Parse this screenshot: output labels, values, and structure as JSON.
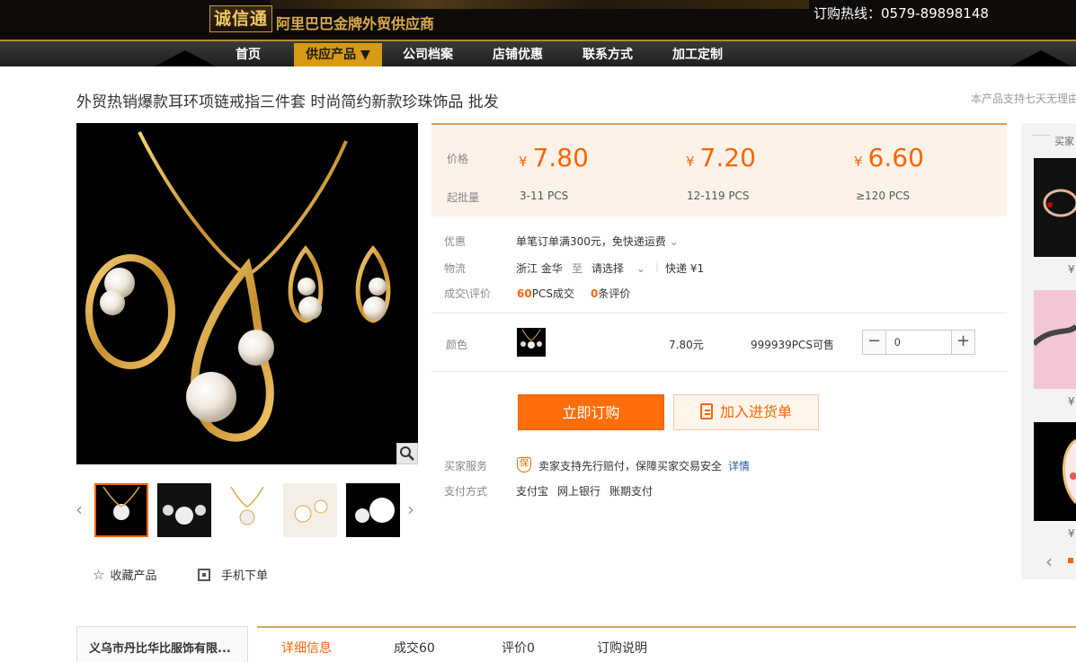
{
  "header": {
    "logo_badge": "诚信通",
    "logo_text": "阿里巴巴金牌外贸供应商",
    "hotline": "订购热线：0579-89898148"
  },
  "nav": [
    {
      "label": "首页"
    },
    {
      "label": "供应产品 ▼"
    },
    {
      "label": "公司档案"
    },
    {
      "label": "店铺优惠"
    },
    {
      "label": "联系方式"
    },
    {
      "label": "加工定制"
    }
  ],
  "product": {
    "title": "外贸热销爆款耳环项链戒指三件套 时尚简约新款珍珠饰品 批发",
    "notice": "本产品支持七天无理由"
  },
  "pricing": {
    "price_label": "价格",
    "moq_label": "起批量",
    "currency": "¥",
    "tiers": [
      {
        "price": "7.80",
        "qty": "3-11 PCS"
      },
      {
        "price": "7.20",
        "qty": "12-119 PCS"
      },
      {
        "price": "6.60",
        "qty": "≥120 PCS"
      }
    ]
  },
  "info": {
    "promo_label": "优惠",
    "promo_value": "单笔订单满300元，免快递运费",
    "logistics_label": "物流",
    "from": "浙江 金华",
    "to_word": "至",
    "to_select": "请选择",
    "express": "快递 ¥1",
    "deals_label": "成交\\评价",
    "deals_count": "60",
    "deals_unit": "PCS成交",
    "reviews_count": "0",
    "reviews_unit": "条评价"
  },
  "sku": {
    "color_label": "颜色",
    "price": "7.80元",
    "stock": "999939PCS可售",
    "quantity": "0"
  },
  "actions": {
    "buy_label": "立即订购",
    "cart_label": "加入进货单"
  },
  "service": {
    "buyer_label": "买家服务",
    "buyer_value": "卖家支持先行赔付，保障买家交易安全",
    "details_link": "详情",
    "pay_label": "支付方式",
    "pay_methods": [
      "支付宝",
      "网上银行",
      "账期支付"
    ]
  },
  "gallery_actions": {
    "favorite": "收藏产品",
    "mobile_order": "手机下单"
  },
  "side": {
    "header": "买家",
    "yen": "¥"
  },
  "bottom": {
    "store": "义乌市丹比华比服饰有限...",
    "tabs": [
      "详细信息",
      "成交60",
      "评价0",
      "订购说明"
    ]
  },
  "colors": {
    "accent": "#f96505",
    "gold": "#d89a12",
    "price_bg": "#fdf2e8"
  }
}
